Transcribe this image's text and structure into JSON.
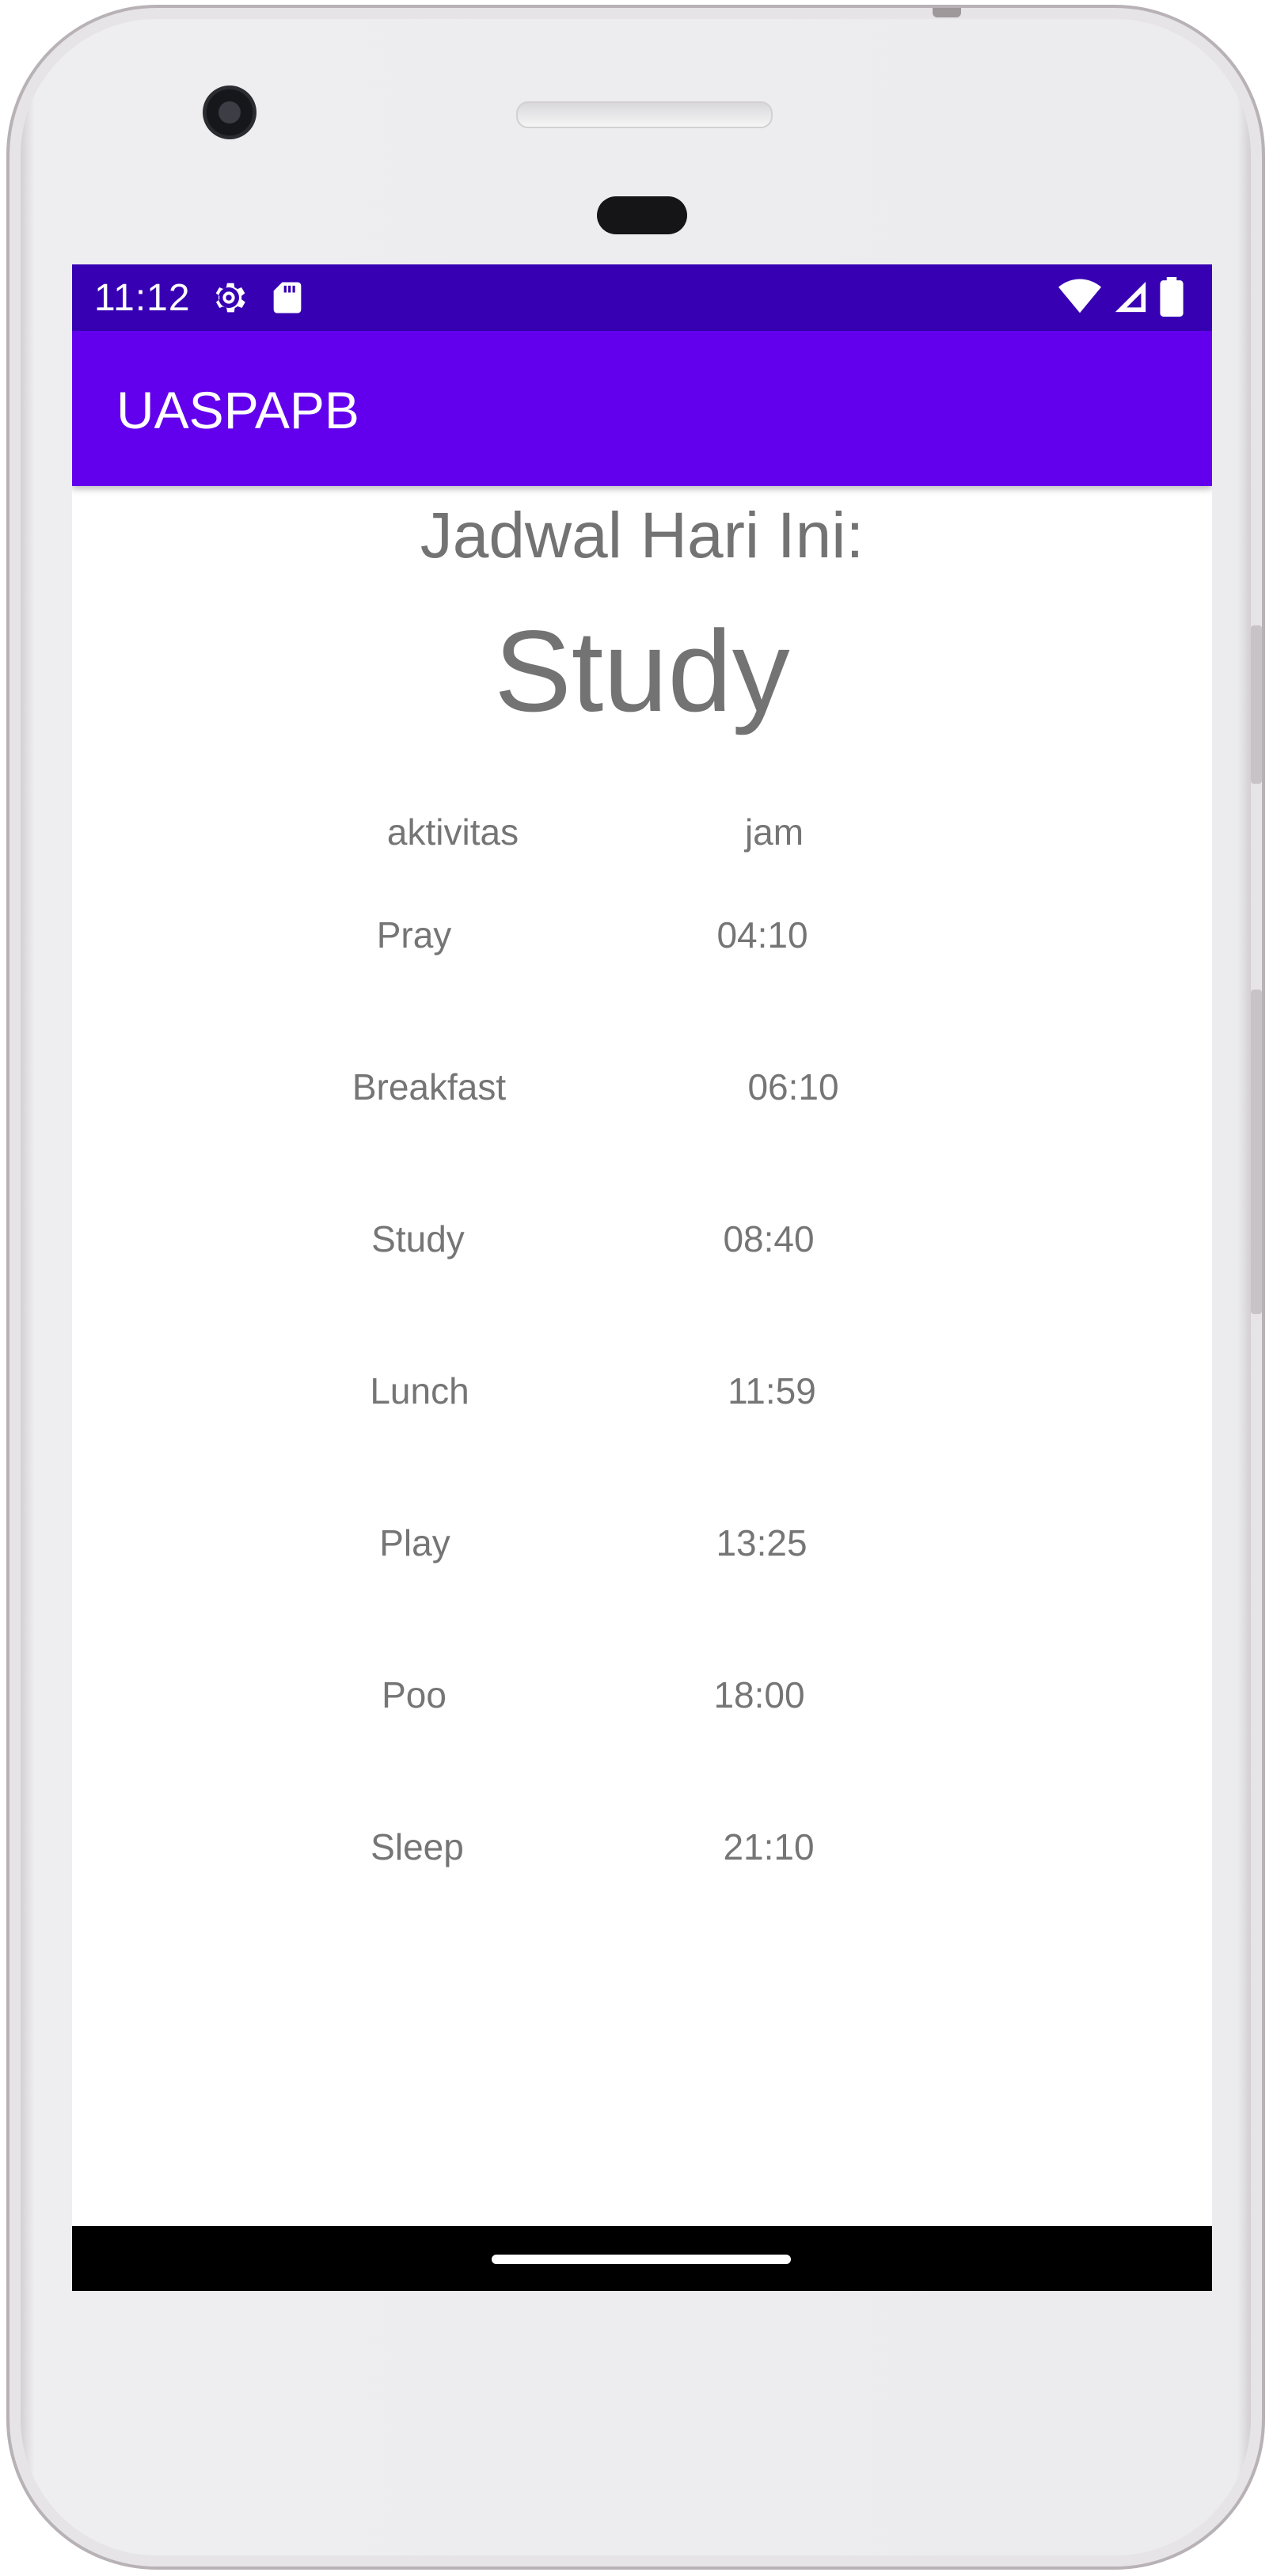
{
  "status_bar": {
    "time": "11:12",
    "icons_left": [
      "settings-gear-icon",
      "sd-card-icon"
    ],
    "icons_right": [
      "wifi-icon",
      "cell-signal-icon",
      "battery-icon"
    ],
    "color": "#3700b3"
  },
  "app_bar": {
    "title": "UASPAPB",
    "color": "#6200ee"
  },
  "main": {
    "heading_label": "Jadwal Hari Ini:",
    "current_activity": "Study",
    "table": {
      "headers": {
        "activity": "aktivitas",
        "time": "jam"
      },
      "rows": [
        {
          "activity": "Pray",
          "time": "04:10"
        },
        {
          "activity": "Breakfast",
          "time": "06:10"
        },
        {
          "activity": "Study",
          "time": "08:40"
        },
        {
          "activity": "Lunch",
          "time": "11:59"
        },
        {
          "activity": "Play",
          "time": "13:25"
        },
        {
          "activity": "Poo",
          "time": "18:00"
        },
        {
          "activity": "Sleep",
          "time": "21:10"
        }
      ]
    }
  }
}
